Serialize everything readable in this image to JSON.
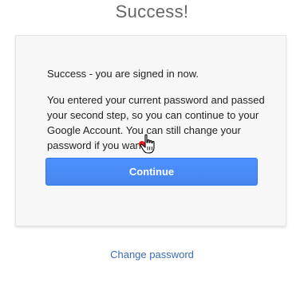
{
  "page": {
    "title": "Success!"
  },
  "card": {
    "success_text": "Success - you are signed in now.",
    "message": "You entered your current password and passed your second step, so you can continue to your Google Account. You can still change your password if you want.",
    "continue_label": "Continue"
  },
  "links": {
    "change_password": "Change password"
  },
  "colors": {
    "button_blue": "#4d90fe",
    "link_blue": "#3a6cba",
    "click_marker": "#e02020"
  },
  "icons": {
    "cursor": "hand-pointer-icon",
    "click_marker": "click-marker-icon"
  }
}
